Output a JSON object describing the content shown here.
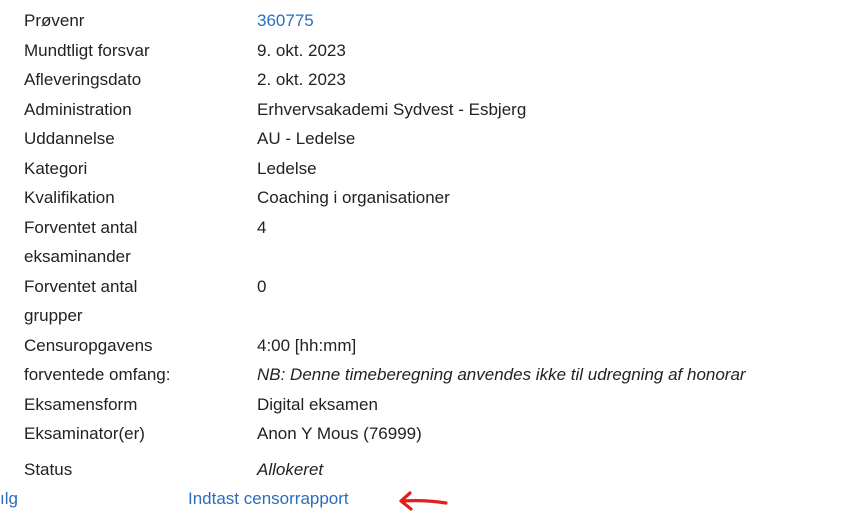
{
  "details": [
    {
      "label": "Prøvenr",
      "value": "360775",
      "link": true
    },
    {
      "label": "Mundtligt forsvar",
      "value": "9. okt. 2023"
    },
    {
      "label": "Afleveringsdato",
      "value": "2. okt. 2023"
    },
    {
      "label": "Administration",
      "value": "Erhvervsakademi Sydvest - Esbjerg"
    },
    {
      "label": "Uddannelse",
      "value": "AU - Ledelse"
    },
    {
      "label": "Kategori",
      "value": "Ledelse"
    },
    {
      "label": "Kvalifikation",
      "value": "Coaching i organisationer"
    },
    {
      "label": "Forventet antal eksaminander",
      "value": "4"
    },
    {
      "label": "Forventet antal grupper",
      "value": "0"
    },
    {
      "label": "Censuropgavens forventede omfang:",
      "value": "4:00 [hh:mm]",
      "note": "NB: Denne timeberegning anvendes ikke til udregning af honorar"
    },
    {
      "label": "Eksamensform",
      "value": "Digital eksamen"
    },
    {
      "label": "Eksaminator(er)",
      "value": "Anon Y Mous (76999)"
    },
    {
      "label": "Status",
      "value": "Allokeret"
    }
  ],
  "footer": {
    "left_fragment": "ılg",
    "report_link": "Indtast censorrapport"
  },
  "colors": {
    "link": "#2a6ebb",
    "text": "#222222",
    "arrow": "#e0201f"
  },
  "icons": {
    "annotation": "red-arrow-left-icon"
  }
}
